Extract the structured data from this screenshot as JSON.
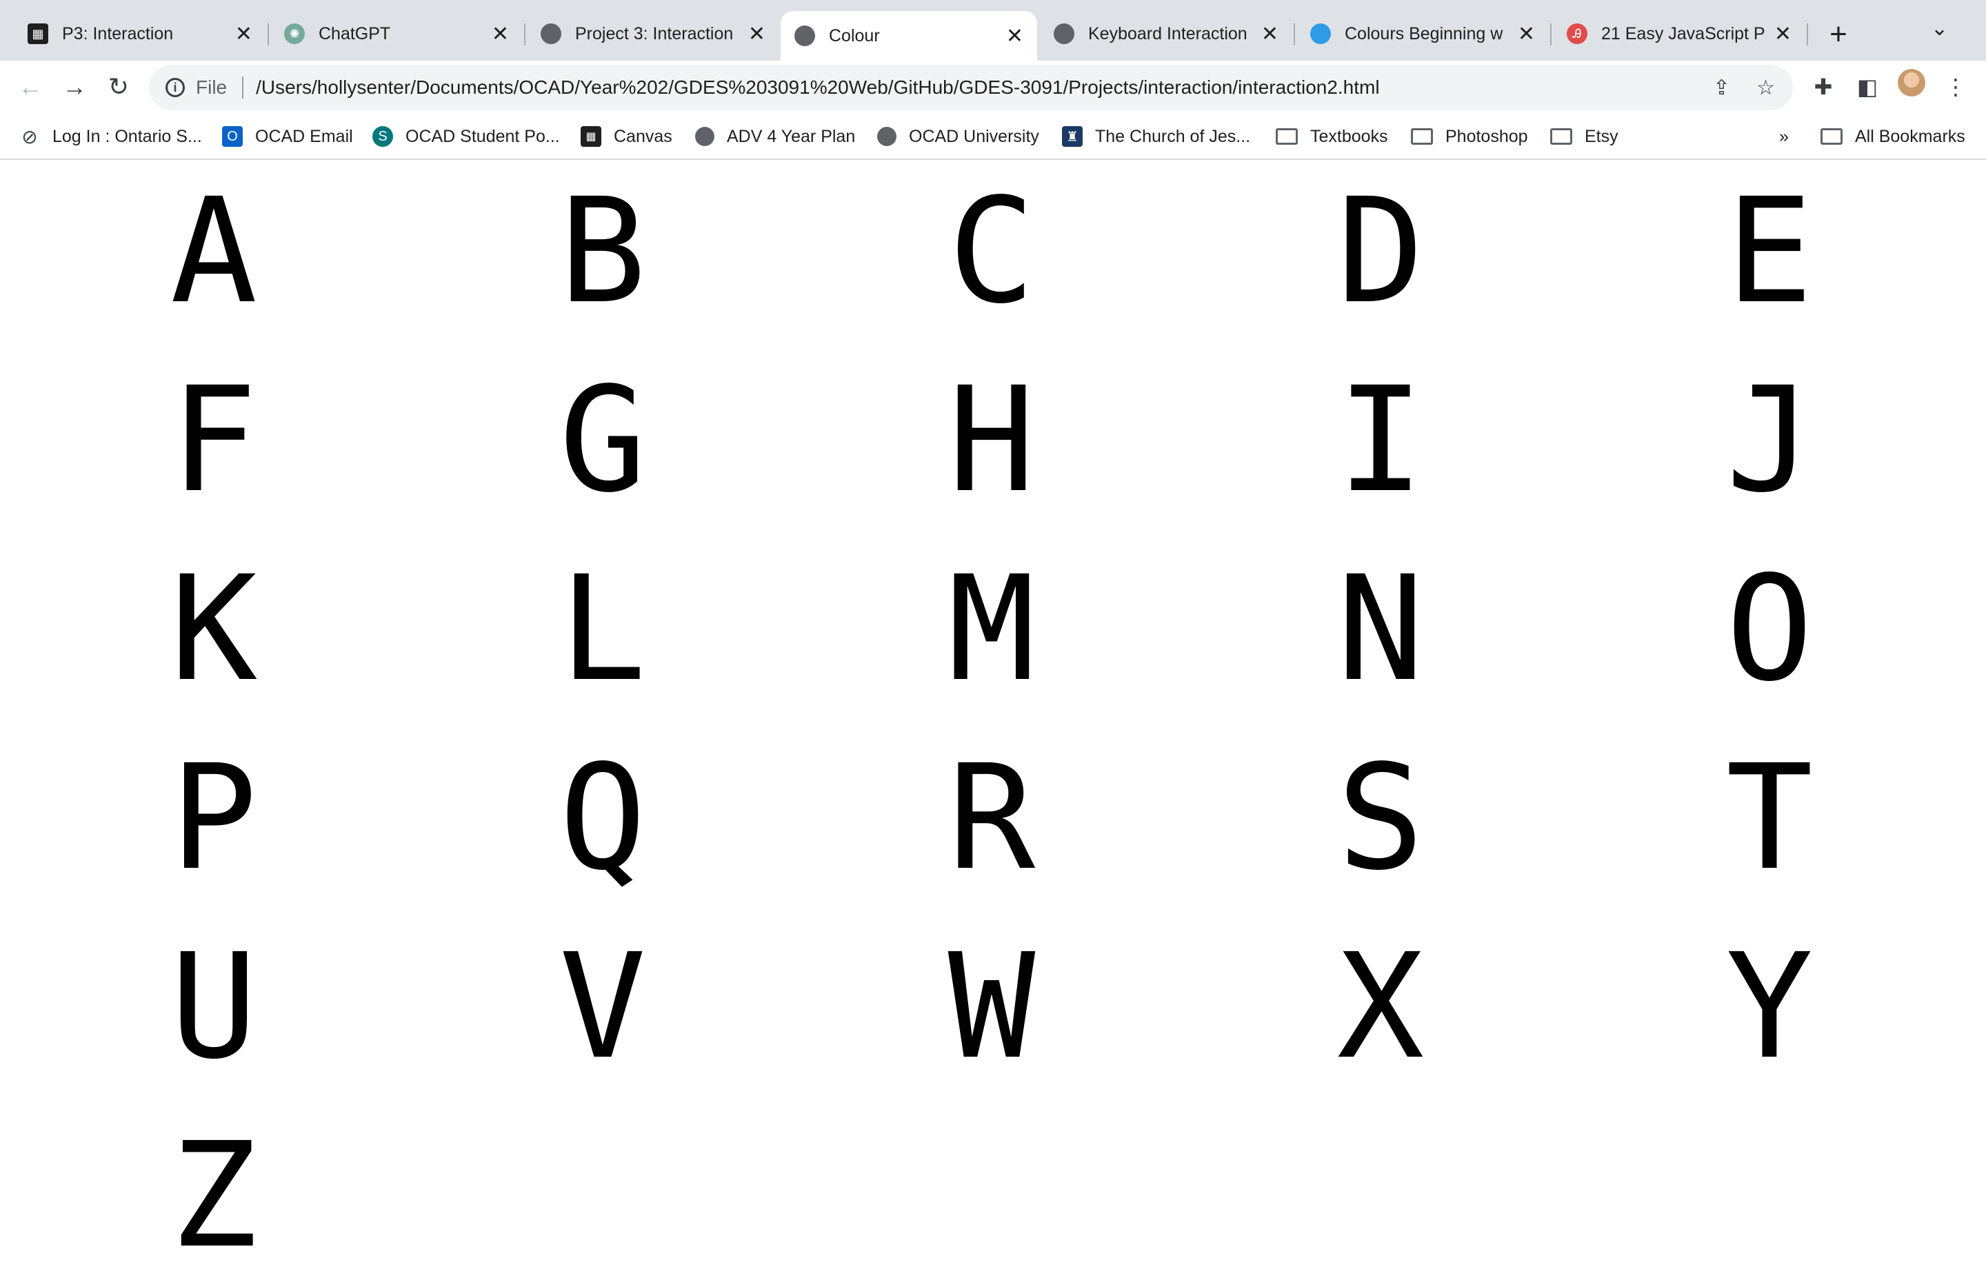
{
  "tabs": [
    {
      "title": "P3: Interaction",
      "icon": "qr-icon",
      "active": false
    },
    {
      "title": "ChatGPT",
      "icon": "chatgpt-icon",
      "active": false
    },
    {
      "title": "Project 3: Interaction",
      "icon": "globe-icon",
      "active": false
    },
    {
      "title": "Colour",
      "icon": "globe-icon",
      "active": true
    },
    {
      "title": "Keyboard Interaction",
      "icon": "globe-icon",
      "active": false
    },
    {
      "title": "Colours Beginning w",
      "icon": "blue-circle-icon",
      "active": false
    },
    {
      "title": "21 Easy JavaScript P",
      "icon": "red-logo-icon",
      "active": false
    }
  ],
  "tab_close_glyph": "✕",
  "new_tab_glyph": "+",
  "tab_menu_glyph": "⌄",
  "toolbar": {
    "back_glyph": "←",
    "forward_glyph": "→",
    "reload_glyph": "↻",
    "scheme": "File",
    "url": "/Users/hollysenter/Documents/OCAD/Year%202/GDES%203091%20Web/GitHub/GDES-3091/Projects/interaction/interaction2.html",
    "share_glyph": "⇪",
    "star_glyph": "☆",
    "extensions_glyph": "✚",
    "sidepanel_glyph": "◧",
    "menu_glyph": "⋮"
  },
  "bookmarks": [
    {
      "label": "Log In : Ontario S...",
      "icon": "link-icon"
    },
    {
      "label": "OCAD Email",
      "icon": "outlook-icon"
    },
    {
      "label": "OCAD Student Po...",
      "icon": "sharepoint-icon"
    },
    {
      "label": "Canvas",
      "icon": "canvas-icon"
    },
    {
      "label": "ADV 4 Year Plan",
      "icon": "globe-icon"
    },
    {
      "label": "OCAD University",
      "icon": "globe-icon"
    },
    {
      "label": "The Church of Jes...",
      "icon": "church-icon"
    },
    {
      "label": "Textbooks",
      "icon": "folder-icon"
    },
    {
      "label": "Photoshop",
      "icon": "folder-icon"
    },
    {
      "label": "Etsy",
      "icon": "folder-icon"
    }
  ],
  "bookmarks_overflow": "»",
  "all_bookmarks": "All Bookmarks",
  "letters": [
    "A",
    "B",
    "C",
    "D",
    "E",
    "F",
    "G",
    "H",
    "I",
    "J",
    "K",
    "L",
    "M",
    "N",
    "O",
    "P",
    "Q",
    "R",
    "S",
    "T",
    "U",
    "V",
    "W",
    "X",
    "Y",
    "Z"
  ],
  "colors": {
    "tabstrip_bg": "#dee1e6",
    "omnibox_bg": "#f1f3f4",
    "letter_color": "#000000",
    "page_bg": "#ffffff"
  }
}
